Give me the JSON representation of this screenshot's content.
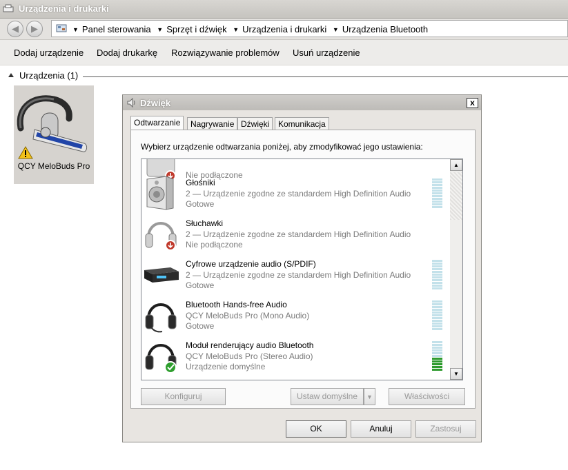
{
  "window": {
    "title": "Urządzenia i drukarki"
  },
  "address": {
    "crumbs": [
      "Panel sterowania",
      "Sprzęt i dźwięk",
      "Urządzenia i drukarki",
      "Urządzenia Bluetooth"
    ]
  },
  "commands": [
    "Dodaj urządzenie",
    "Dodaj drukarkę",
    "Rozwiązywanie problemów",
    "Usuń urządzenie"
  ],
  "group": {
    "label": "Urządzenia (1)"
  },
  "device": {
    "name": "QCY MeloBuds Pro",
    "status_icon": "warning-icon"
  },
  "dialog": {
    "title": "Dźwięk",
    "close": "x",
    "tabs": [
      "Odtwarzanie",
      "Nagrywanie",
      "Dźwięki",
      "Komunikacja"
    ],
    "instruction": "Wybierz urządzenie odtwarzania poniżej, aby zmodyfikować jego ustawienia:",
    "devices": [
      {
        "name": "",
        "desc": "",
        "status": "Nie podłączone",
        "icon": "disconnected-device-icon",
        "meter": null
      },
      {
        "name": "Głośniki",
        "desc": "2 — Urządzenie zgodne ze standardem High Definition Audio",
        "status": "Gotowe",
        "icon": "speakers-icon",
        "meter": 0
      },
      {
        "name": "Słuchawki",
        "desc": "2 — Urządzenie zgodne ze standardem High Definition Audio",
        "status": "Nie podłączone",
        "icon": "headphones-icon",
        "meter": null
      },
      {
        "name": "Cyfrowe urządzenie audio (S/PDIF)",
        "desc": "2 — Urządzenie zgodne ze standardem High Definition Audio",
        "status": "Gotowe",
        "icon": "digital-audio-icon",
        "meter": 0
      },
      {
        "name": "Bluetooth Hands-free Audio",
        "desc": "QCY MeloBuds Pro (Mono Audio)",
        "status": "Gotowe",
        "icon": "headset-icon",
        "meter": 0
      },
      {
        "name": "Moduł renderujący audio Bluetooth",
        "desc": "QCY MeloBuds Pro (Stereo Audio)",
        "status": "Urządzenie domyślne",
        "icon": "headset-default-icon",
        "meter": 0.45
      }
    ],
    "buttons": {
      "configure": "Konfiguruj",
      "set_default": "Ustaw domyślne",
      "properties": "Właściwości",
      "ok": "OK",
      "cancel": "Anuluj",
      "apply": "Zastosuj"
    }
  },
  "colors": {
    "meter_active": "#2d9a2d",
    "meter_idle": "#c3e1ea"
  }
}
